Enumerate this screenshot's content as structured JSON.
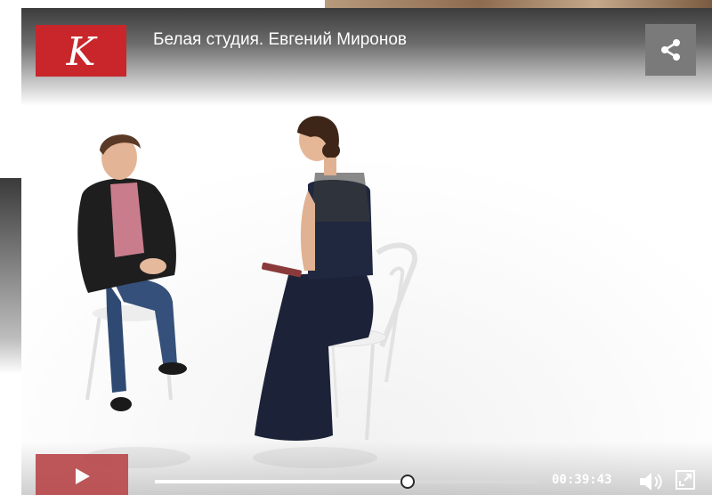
{
  "player": {
    "title": "Белая студия. Евгений Миронов",
    "current_time": "00:39:43",
    "progress_fraction": 0.66
  },
  "logo": {
    "letter": "K"
  },
  "icons": {
    "share": "share-icon",
    "play": "play-icon",
    "volume": "volume-icon",
    "fullscreen": "fullscreen-icon"
  },
  "colors": {
    "logo_bg": "#c8262b",
    "play_button": "#b9474a",
    "share_button": "#7a7a7a"
  }
}
